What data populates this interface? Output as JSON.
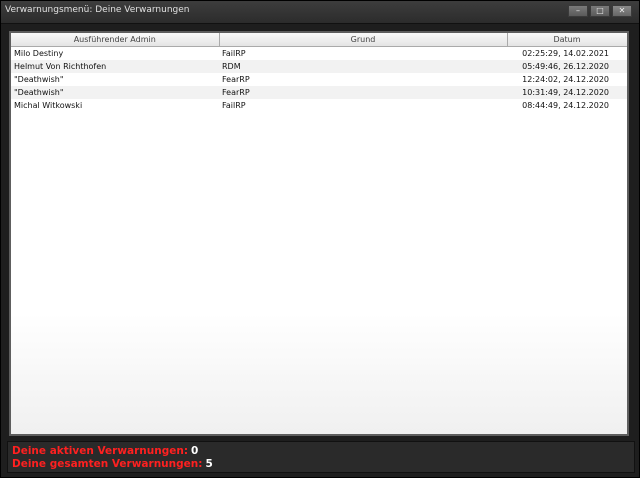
{
  "window": {
    "title": "Verwarnungsmenü: Deine Verwarnungen",
    "controls": {
      "minimize": "–",
      "maximize": "□",
      "close": "✕"
    }
  },
  "table": {
    "columns": [
      "Ausführender Admin",
      "Grund",
      "Datum"
    ],
    "rows": [
      {
        "admin": "Milo Destiny",
        "grund": "FailRP",
        "datum": "02:25:29, 14.02.2021"
      },
      {
        "admin": "Helmut Von Richthofen",
        "grund": "RDM",
        "datum": "05:49:46, 26.12.2020"
      },
      {
        "admin": "\"Deathwish\"",
        "grund": "FearRP",
        "datum": "12:24:02, 24.12.2020"
      },
      {
        "admin": "\"Deathwish\"",
        "grund": "FearRP",
        "datum": "10:31:49, 24.12.2020"
      },
      {
        "admin": "Michal Witkowski",
        "grund": "FailRP",
        "datum": "08:44:49, 24.12.2020"
      }
    ]
  },
  "footer": {
    "active_label": "Deine aktiven Verwarnungen:",
    "active_value": "0",
    "total_label": "Deine gesamten Verwarnungen:",
    "total_value": "5"
  },
  "colors": {
    "label_red": "#ff2020",
    "value_white": "#ffffff"
  }
}
